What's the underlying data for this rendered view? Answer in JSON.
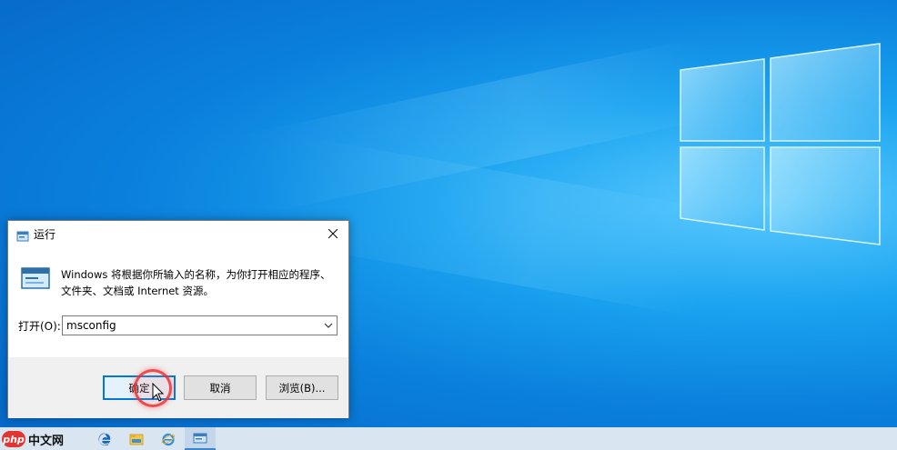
{
  "desktop": {
    "background_color": "#0a7fdc",
    "logo_icon": "windows-logo-icon"
  },
  "run_dialog": {
    "title": "运行",
    "title_icon": "run-icon",
    "close_icon": "close-icon",
    "description_line1": "Windows 将根据你所输入的名称，为你打开相应的程序、",
    "description_line2": "文件夹、文档或 Internet 资源。",
    "open_label": "打开(O):",
    "open_value": "msconfig",
    "ok_label": "确定",
    "cancel_label": "取消",
    "browse_label": "浏览(B)..."
  },
  "taskbar": {
    "watermark_logo": "php",
    "watermark_text": "中文网",
    "items": [
      "edge-icon",
      "file-explorer-icon",
      "ie-icon",
      "run-icon"
    ],
    "background_color": "#d9e6f2"
  }
}
